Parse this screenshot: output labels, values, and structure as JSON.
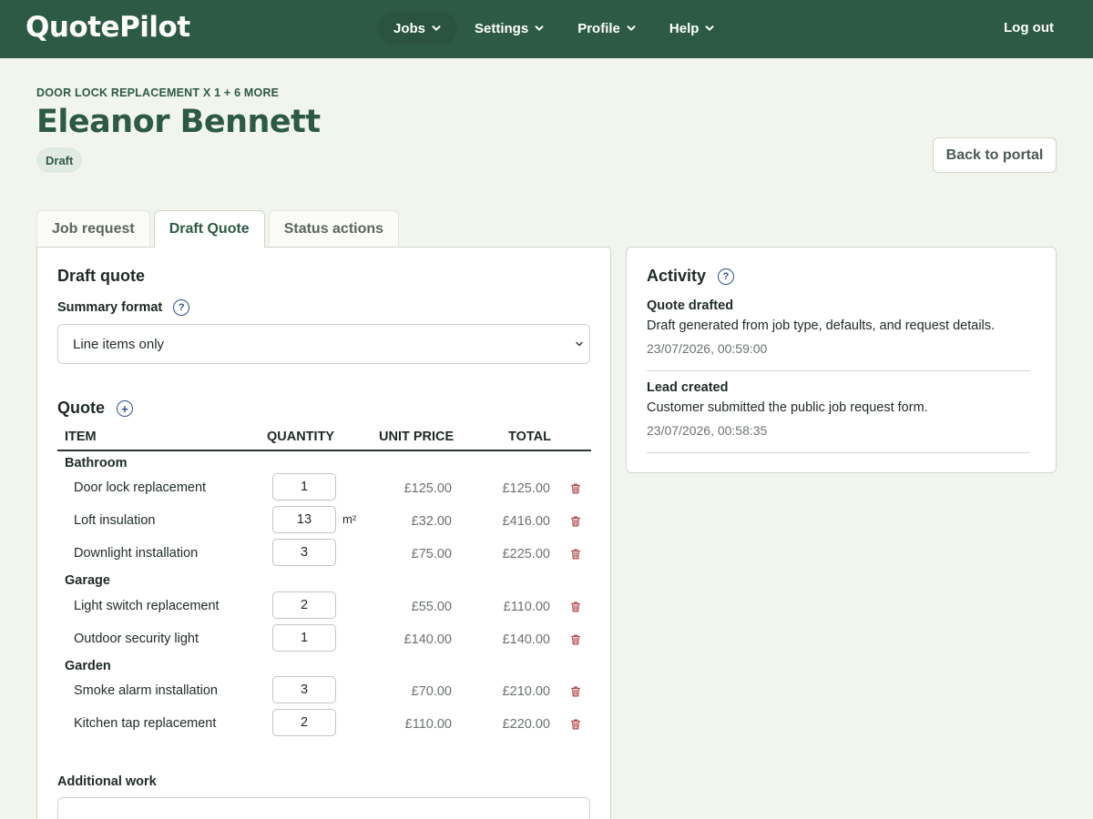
{
  "app": {
    "brand": "QuotePilot",
    "logout_label": "Log out"
  },
  "nav": {
    "items": [
      {
        "label": "Jobs",
        "active": true
      },
      {
        "label": "Settings",
        "active": false
      },
      {
        "label": "Profile",
        "active": false
      },
      {
        "label": "Help",
        "active": false
      }
    ]
  },
  "header": {
    "eyebrow": "DOOR LOCK REPLACEMENT X 1 + 6 MORE",
    "title": "Eleanor Bennett",
    "status": "Draft",
    "back_label": "Back to portal"
  },
  "tabs": [
    {
      "label": "Job request",
      "active": false
    },
    {
      "label": "Draft Quote",
      "active": true
    },
    {
      "label": "Status actions",
      "active": false
    }
  ],
  "draft_quote": {
    "title": "Draft quote",
    "summary_label": "Summary format",
    "summary_value": "Line items only",
    "quote_title": "Quote",
    "columns": {
      "item": "ITEM",
      "quantity": "QUANTITY",
      "unit_price": "UNIT PRICE",
      "total": "TOTAL"
    },
    "groups": [
      {
        "name": "Bathroom",
        "items": [
          {
            "name": "Door lock replacement",
            "quantity": "1",
            "unit": "",
            "unit_price": "£125.00",
            "total": "£125.00"
          },
          {
            "name": "Loft insulation",
            "quantity": "13",
            "unit": "m²",
            "unit_price": "£32.00",
            "total": "£416.00"
          },
          {
            "name": "Downlight installation",
            "quantity": "3",
            "unit": "",
            "unit_price": "£75.00",
            "total": "£225.00"
          }
        ]
      },
      {
        "name": "Garage",
        "items": [
          {
            "name": "Light switch replacement",
            "quantity": "2",
            "unit": "",
            "unit_price": "£55.00",
            "total": "£110.00"
          },
          {
            "name": "Outdoor security light",
            "quantity": "1",
            "unit": "",
            "unit_price": "£140.00",
            "total": "£140.00"
          }
        ]
      },
      {
        "name": "Garden",
        "items": [
          {
            "name": "Smoke alarm installation",
            "quantity": "3",
            "unit": "",
            "unit_price": "£70.00",
            "total": "£210.00"
          },
          {
            "name": "Kitchen tap replacement",
            "quantity": "2",
            "unit": "",
            "unit_price": "£110.00",
            "total": "£220.00"
          }
        ]
      }
    ],
    "additional_work_label": "Additional work"
  },
  "activity": {
    "title": "Activity",
    "entries": [
      {
        "title": "Quote drafted",
        "description": "Draft generated from job type, defaults, and request details.",
        "time": "23/07/2026, 00:59:00"
      },
      {
        "title": "Lead created",
        "description": "Customer submitted the public job request form.",
        "time": "23/07/2026, 00:58:35"
      }
    ]
  },
  "colors": {
    "brand": "#2d5a45",
    "background": "#f2f5ee",
    "help_icon": "#2d4f8a",
    "delete_icon": "#b5504f"
  },
  "icons": {
    "nav_chevron": "chevron-down-icon",
    "help": "help-icon",
    "add": "add-icon",
    "delete": "trash-icon"
  }
}
